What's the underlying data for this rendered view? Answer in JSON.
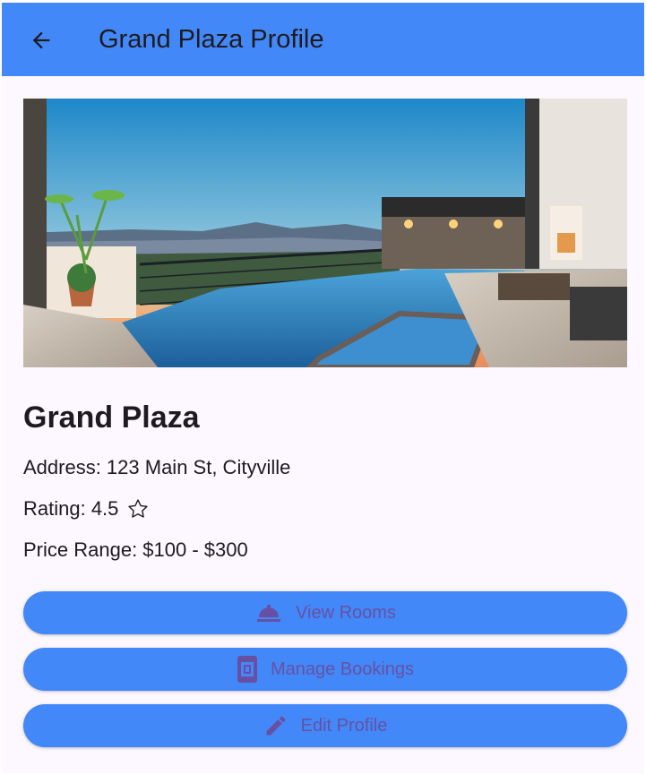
{
  "appbar": {
    "title": "Grand Plaza Profile",
    "back_icon": "arrow-back-icon"
  },
  "hotel": {
    "name": "Grand Plaza",
    "address": "Address: 123 Main St, Cityville",
    "rating": "Rating: 4.5",
    "price_range": "Price Range: $100 - $300"
  },
  "actions": [
    {
      "label": "View Rooms",
      "icon": "room-service-icon"
    },
    {
      "label": "Manage Bookings",
      "icon": "book-icon"
    },
    {
      "label": "Edit Profile",
      "icon": "edit-pencil-icon"
    }
  ],
  "colors": {
    "primary": "#4388f8",
    "button_text": "#6750a4",
    "background": "#fdf7ff"
  }
}
